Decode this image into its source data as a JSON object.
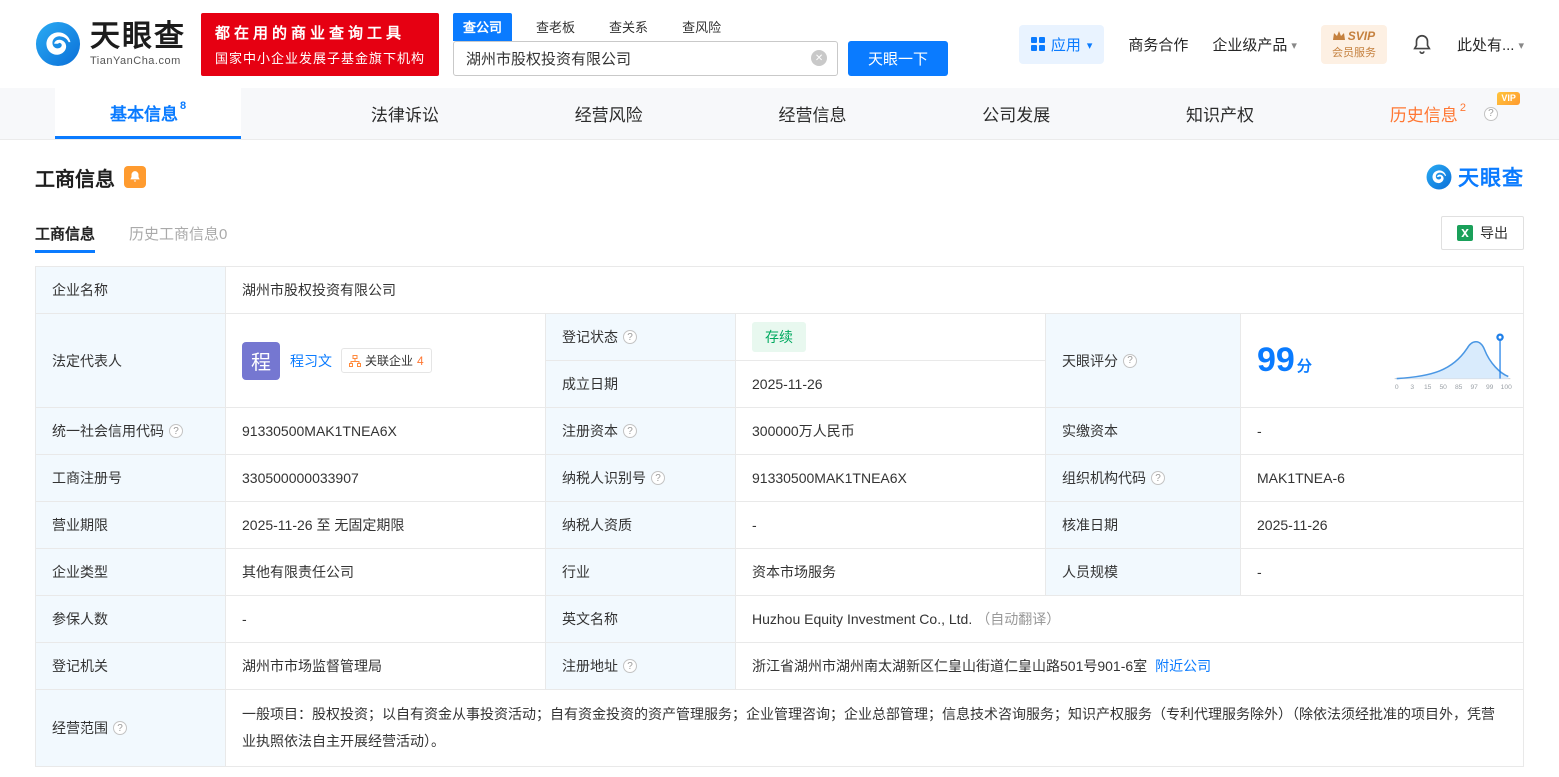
{
  "header": {
    "logo_cn": "天眼查",
    "logo_en": "TianYanCha.com",
    "slogan_line1": "都在用的商业查询工具",
    "slogan_line2": "国家中小企业发展子基金旗下机构",
    "search_tabs": [
      "查公司",
      "查老板",
      "查关系",
      "查风险"
    ],
    "search_value": "湖州市股权投资有限公司",
    "search_button": "天眼一下",
    "nav_apps": "应用",
    "nav_cooperation": "商务合作",
    "nav_enterprise": "企业级产品",
    "svip_top": "SVIP",
    "svip_bottom": "会员服务",
    "nav_more": "此处有..."
  },
  "tabs": {
    "basic": "基本信息",
    "basic_badge": "8",
    "legal": "法律诉讼",
    "risk": "经营风险",
    "business": "经营信息",
    "development": "公司发展",
    "ip": "知识产权",
    "history": "历史信息",
    "history_badge": "2",
    "history_vip": "VIP"
  },
  "section": {
    "title": "工商信息",
    "watermark": "天眼查",
    "subtab_active": "工商信息",
    "subtab_history": "历史工商信息0",
    "export_label": "导出"
  },
  "table": {
    "company_name_label": "企业名称",
    "company_name": "湖州市股权投资有限公司",
    "legal_rep_label": "法定代表人",
    "avatar_char": "程",
    "legal_rep_name": "程习文",
    "related_label": "关联企业",
    "related_count": "4",
    "reg_status_label": "登记状态",
    "reg_status_value": "存续",
    "establish_label": "成立日期",
    "establish_value": "2025-11-26",
    "score_label": "天眼评分",
    "score_value": "99",
    "score_unit": "分",
    "rows": [
      {
        "cells": [
          {
            "label": "统一社会信用代码",
            "value": "91330500MAK1TNEA6X"
          },
          {
            "label": "注册资本",
            "value": "300000万人民币"
          },
          {
            "label": "实缴资本",
            "value": "-"
          }
        ]
      },
      {
        "cells": [
          {
            "label": "工商注册号",
            "value": "330500000033907"
          },
          {
            "label": "纳税人识别号",
            "value": "91330500MAK1TNEA6X"
          },
          {
            "label": "组织机构代码",
            "value": "MAK1TNEA-6"
          }
        ]
      },
      {
        "cells": [
          {
            "label": "营业期限",
            "value": "2025-11-26 至 无固定期限"
          },
          {
            "label": "纳税人资质",
            "value": "-"
          },
          {
            "label": "核准日期",
            "value": "2025-11-26"
          }
        ]
      },
      {
        "cells": [
          {
            "label": "企业类型",
            "value": "其他有限责任公司"
          },
          {
            "label": "行业",
            "value": "资本市场服务"
          },
          {
            "label": "人员规模",
            "value": "-"
          }
        ]
      }
    ],
    "insured_label": "参保人数",
    "insured_value": "-",
    "english_label": "英文名称",
    "english_value": "Huzhou Equity Investment Co., Ltd.",
    "english_note": "（自动翻译）",
    "registry_label": "登记机关",
    "registry_value": "湖州市市场监督管理局",
    "address_label": "注册地址",
    "address_value": "浙江省湖州市湖州南太湖新区仁皇山街道仁皇山路501号901-6室",
    "address_link": "附近公司",
    "scope_label": "经营范围",
    "scope_value": "一般项目：股权投资；以自有资金从事投资活动；自有资金投资的资产管理服务；企业管理咨询；企业总部管理；信息技术咨询服务；知识产权服务（专利代理服务除外）（除依法须经批准的项目外，凭营业执照依法自主开展经营活动）。"
  },
  "score_chart": {
    "ticks": [
      "0",
      "3",
      "15",
      "50",
      "85",
      "97",
      "99",
      "100"
    ]
  }
}
